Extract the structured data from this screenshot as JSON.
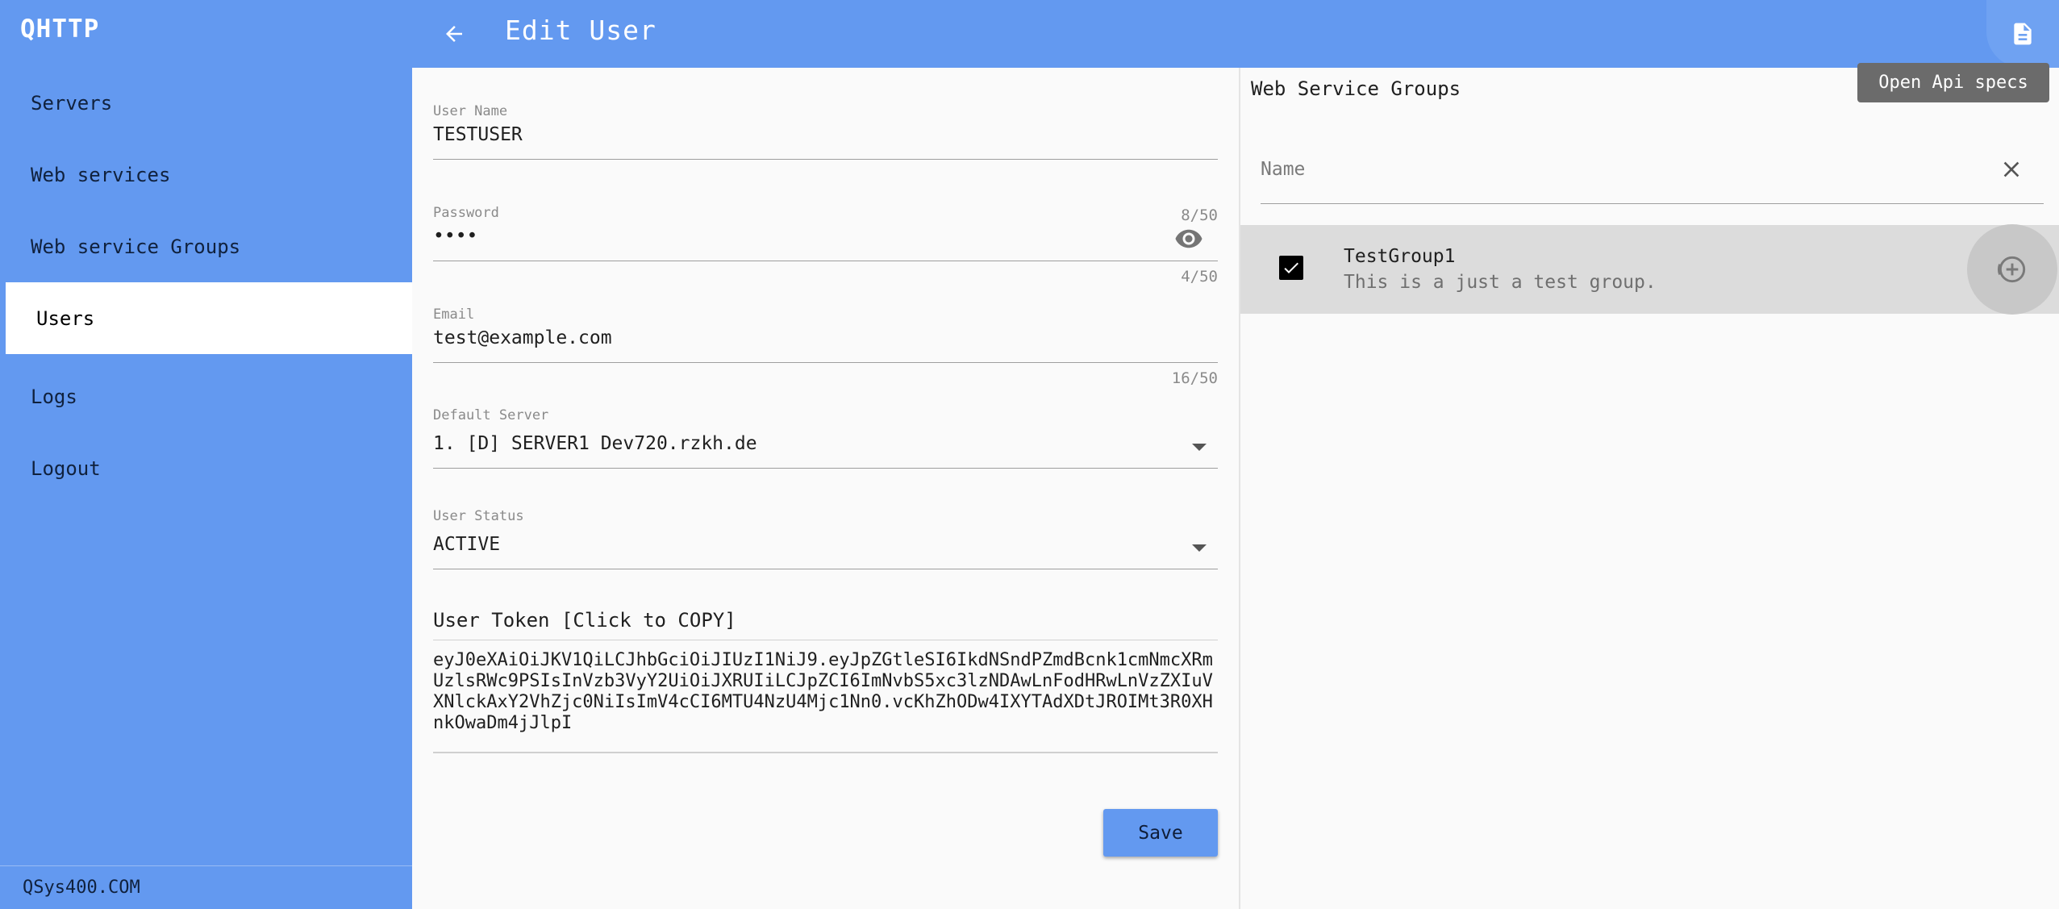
{
  "app": {
    "brand": "QHTTP",
    "footer": "QSys400.COM"
  },
  "sidebar": {
    "items": [
      {
        "label": "Servers"
      },
      {
        "label": "Web services"
      },
      {
        "label": "Web service Groups"
      },
      {
        "label": "Users",
        "active": true
      },
      {
        "label": "Logs"
      },
      {
        "label": "Logout"
      }
    ]
  },
  "header": {
    "title": "Edit User",
    "api_tooltip": "Open Api specs",
    "icons": {
      "back": "arrow-left-icon",
      "api": "document-icon"
    }
  },
  "form": {
    "username": {
      "label": "User Name",
      "value": "TESTUSER",
      "counter": "8/50"
    },
    "password": {
      "label": "Password",
      "value": "••••",
      "counter": "4/50"
    },
    "email": {
      "label": "Email",
      "value": "test@example.com",
      "counter": "16/50"
    },
    "default_server": {
      "label": "Default Server",
      "value": "1. [D] SERVER1 Dev720.rzkh.de"
    },
    "user_status": {
      "label": "User Status",
      "value": "ACTIVE"
    },
    "token": {
      "title": "User Token [Click to COPY]",
      "value": "eyJ0eXAiOiJKV1QiLCJhbGciOiJIUzI1NiJ9.eyJpZGtleSI6IkdNSndPZmdBcnk1cmNmcXRmUzlsRWc9PSIsInVzb3VyY2UiOiJXRUIiLCJpZCI6ImNvbS5xc3lzNDAwLnFodHRwLnVzZXIuVXNlckAxY2VhZjc0NiIsImV4cCI6MTU4NzU4Mjc1Nn0.vcKhZhODw4IXYTAdXDtJROIMt3R0XHnkOwaDm4jJlpI"
    },
    "save_label": "Save"
  },
  "groups": {
    "title": "Web Service Groups",
    "filter_placeholder": "Name",
    "items": [
      {
        "name": "TestGroup1",
        "description": "This is a just a test group.",
        "checked": true
      }
    ]
  },
  "colors": {
    "accent": "#6399f0",
    "sidebar_text": "#10213d"
  }
}
